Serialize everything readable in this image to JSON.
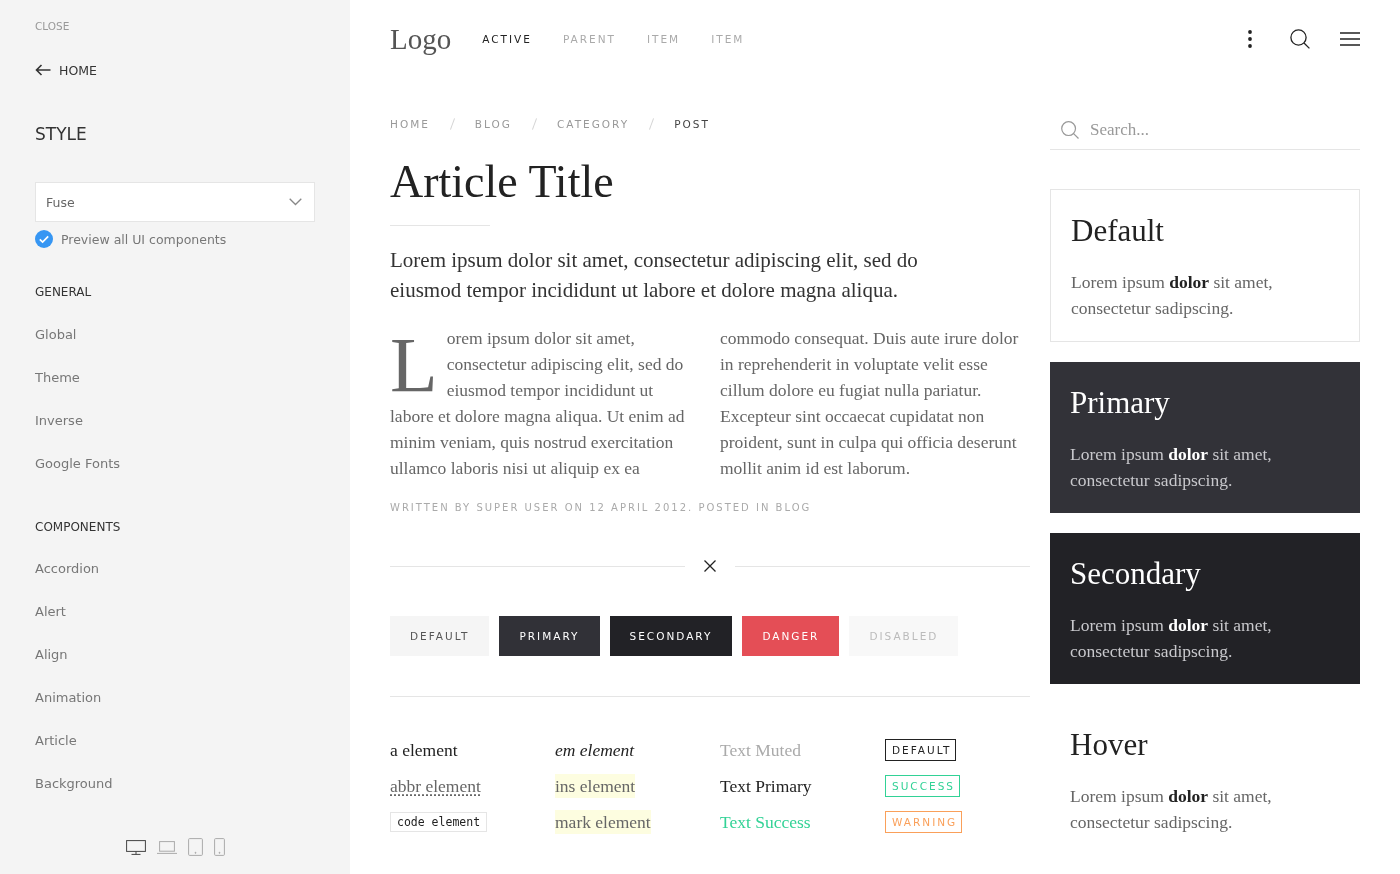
{
  "sidebar": {
    "close": "CLOSE",
    "back_link": "HOME",
    "style_heading": "STYLE",
    "style_select": {
      "value": "Fuse"
    },
    "preview_checkbox": {
      "label": "Preview all UI components",
      "checked": true
    },
    "sections": [
      {
        "heading": "GENERAL",
        "items": [
          "Global",
          "Theme",
          "Inverse",
          "Google Fonts"
        ]
      },
      {
        "heading": "COMPONENTS",
        "items": [
          "Accordion",
          "Alert",
          "Align",
          "Animation",
          "Article",
          "Background"
        ]
      }
    ],
    "devices": [
      {
        "kind": "desktop",
        "selected": true
      },
      {
        "kind": "laptop",
        "selected": false
      },
      {
        "kind": "tablet",
        "selected": false
      },
      {
        "kind": "phone",
        "selected": false
      }
    ]
  },
  "navbar": {
    "logo": "Logo",
    "items": [
      {
        "label": "ACTIVE",
        "selected": true
      },
      {
        "label": "PARENT",
        "selected": false
      },
      {
        "label": "ITEM",
        "selected": false
      },
      {
        "label": "ITEM",
        "selected": false
      }
    ]
  },
  "breadcrumb": [
    {
      "label": "HOME",
      "current": false
    },
    {
      "label": "BLOG",
      "current": false
    },
    {
      "label": "CATEGORY",
      "current": false
    },
    {
      "label": "POST",
      "current": true
    }
  ],
  "article": {
    "title": "Article Title",
    "lead": "Lorem ipsum dolor sit amet, consectetur adipiscing elit, sed do eiusmod tempor incididunt ut labore et dolore magna aliqua.",
    "body": "Lorem ipsum dolor sit amet, consectetur adipiscing elit, sed do eiusmod tempor incididunt ut labore et dolore magna aliqua. Ut enim ad minim veniam, quis nostrud exercitation ullamco laboris nisi ut aliquip ex ea commodo consequat. Duis aute irure dolor in reprehenderit in voluptate velit esse cillum dolore eu fugiat nulla pariatur. Excepteur sint occaecat cupidatat non proident, sunt in culpa qui officia deserunt mollit anim id est laborum.",
    "meta": "WRITTEN BY SUPER USER ON 12 APRIL 2012. POSTED IN BLOG"
  },
  "buttons": [
    {
      "label": "DEFAULT",
      "kind": "default",
      "disabled": false
    },
    {
      "label": "PRIMARY",
      "kind": "primary",
      "disabled": false
    },
    {
      "label": "SECONDARY",
      "kind": "secondary",
      "disabled": false
    },
    {
      "label": "DANGER",
      "kind": "danger",
      "disabled": false
    },
    {
      "label": "DISABLED",
      "kind": "default",
      "disabled": true
    }
  ],
  "text_columns": [
    {
      "items": [
        {
          "kind": "link",
          "text": "a element"
        },
        {
          "kind": "abbr",
          "text": "abbr element"
        },
        {
          "kind": "code",
          "text": "code element"
        }
      ]
    },
    {
      "items": [
        {
          "kind": "em",
          "text": "em element"
        },
        {
          "kind": "ins",
          "text": "ins element"
        },
        {
          "kind": "mark",
          "text": "mark element"
        }
      ]
    },
    {
      "items": [
        {
          "kind": "muted",
          "text": "Text Muted"
        },
        {
          "kind": "primary",
          "text": "Text Primary"
        },
        {
          "kind": "success",
          "text": "Text Success"
        }
      ]
    }
  ],
  "labels": [
    {
      "label": "DEFAULT",
      "kind": "default"
    },
    {
      "label": "SUCCESS",
      "kind": "success"
    },
    {
      "label": "WARNING",
      "kind": "warning"
    }
  ],
  "search": {
    "placeholder": "Search..."
  },
  "cards": [
    {
      "kind": "default",
      "title": "Default",
      "text": "Lorem ipsum **dolor** sit amet, consectetur sadipscing."
    },
    {
      "kind": "primary",
      "title": "Primary",
      "text": "Lorem ipsum **dolor** sit amet, consectetur sadipscing."
    },
    {
      "kind": "secondary",
      "title": "Secondary",
      "text": "Lorem ipsum **dolor** sit amet, consectetur sadipscing."
    },
    {
      "kind": "hover",
      "title": "Hover",
      "text": "Lorem ipsum **dolor** sit amet, consectetur sadipscing."
    }
  ]
}
